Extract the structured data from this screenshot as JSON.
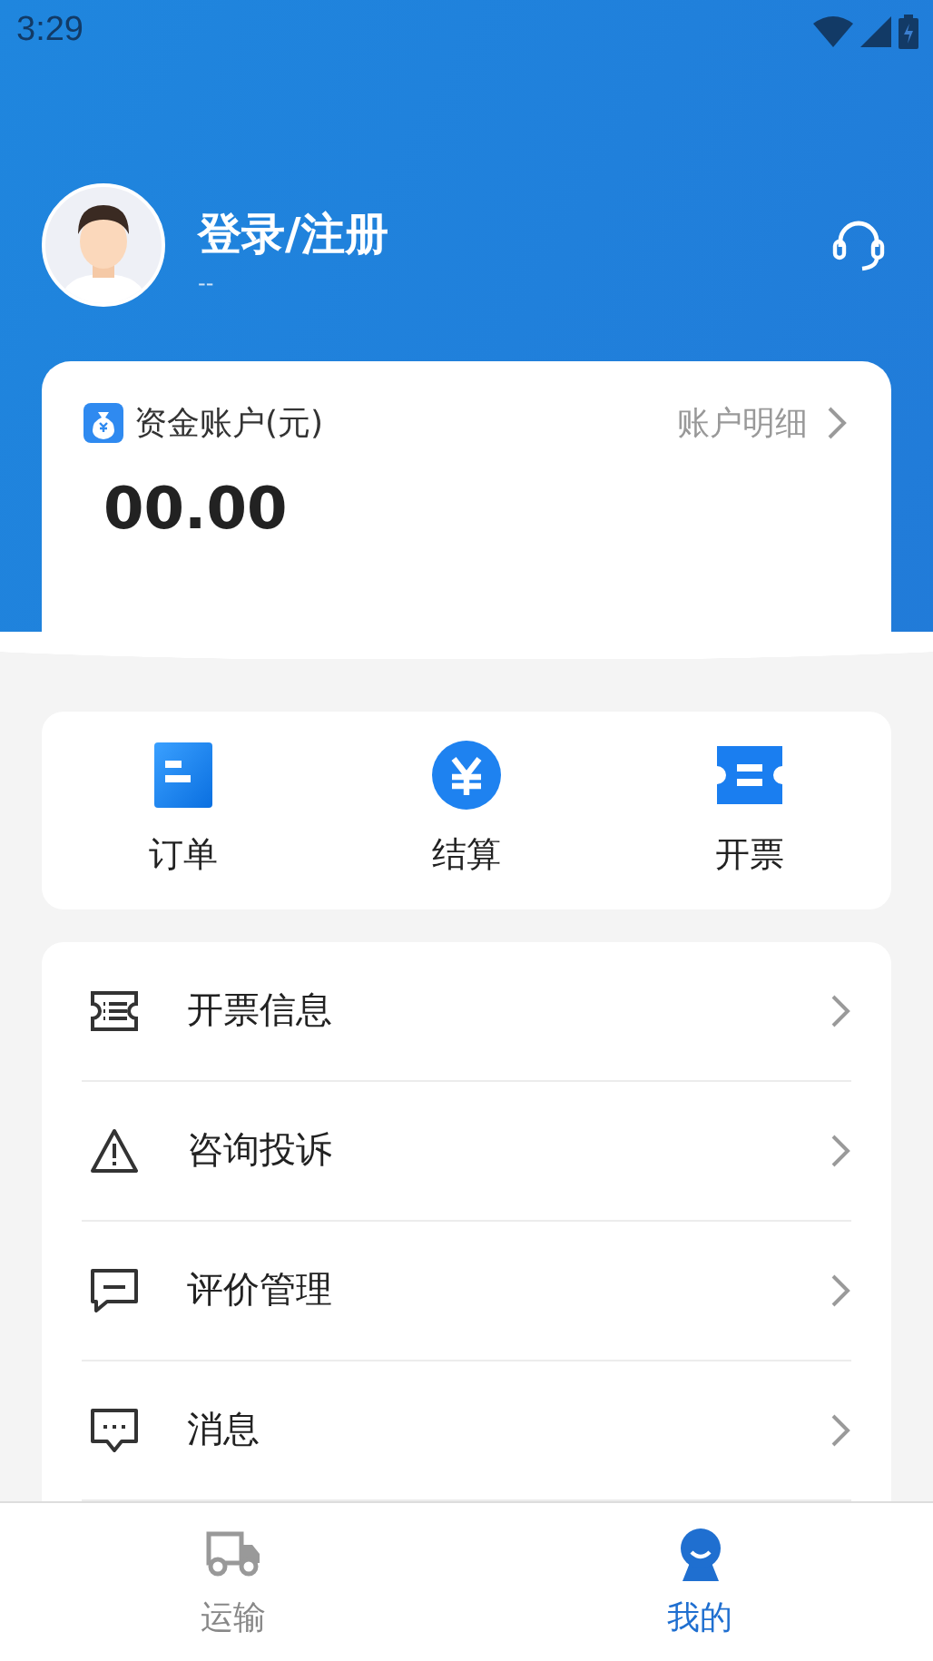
{
  "status_bar": {
    "time": "3:29"
  },
  "profile": {
    "name": "登录/注册",
    "subtitle": "--"
  },
  "account": {
    "title": "资金账户(元)",
    "link": "账户明细",
    "balance": "00.00"
  },
  "quick_actions": [
    {
      "label": "订单",
      "kind": "order"
    },
    {
      "label": "结算",
      "kind": "settle"
    },
    {
      "label": "开票",
      "kind": "invoice"
    }
  ],
  "menu": [
    {
      "label": "开票信息",
      "kind": "invoice"
    },
    {
      "label": "咨询投诉",
      "kind": "warning"
    },
    {
      "label": "评价管理",
      "kind": "comment"
    },
    {
      "label": "消息",
      "kind": "message"
    }
  ],
  "bottom_nav": [
    {
      "label": "运输",
      "kind": "truck",
      "selected": false
    },
    {
      "label": "我的",
      "kind": "person",
      "selected": true
    }
  ]
}
